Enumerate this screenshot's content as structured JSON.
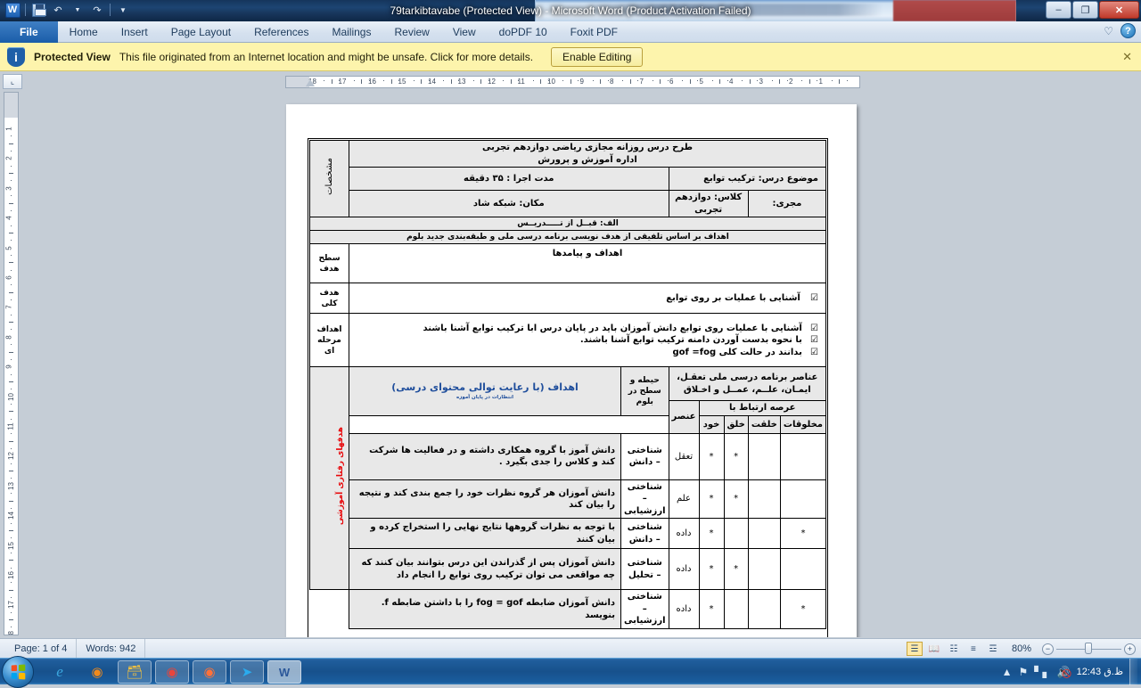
{
  "titlebar": {
    "document_title": "79tarkibtavabe (Protected View)  -  Microsoft Word (Product Activation Failed)",
    "quick_access": [
      "word-icon",
      "save-icon",
      "undo-icon",
      "redo-icon",
      "customize-icon"
    ],
    "minimize_label": "–",
    "restore_label": "❐",
    "close_label": "✕"
  },
  "ribbon": {
    "tabs": [
      {
        "label": "File",
        "active": true
      },
      {
        "label": "Home",
        "active": false
      },
      {
        "label": "Insert",
        "active": false
      },
      {
        "label": "Page Layout",
        "active": false
      },
      {
        "label": "References",
        "active": false
      },
      {
        "label": "Mailings",
        "active": false
      },
      {
        "label": "Review",
        "active": false
      },
      {
        "label": "View",
        "active": false
      },
      {
        "label": "doPDF 10",
        "active": false
      },
      {
        "label": "Foxit PDF",
        "active": false
      }
    ],
    "minimize_ribbon_label": "♡",
    "help_label": "?"
  },
  "protected_view": {
    "title": "Protected View",
    "message": "This file originated from an Internet location and might be unsafe. Click for more details.",
    "enable_button": "Enable Editing",
    "close_label": "✕",
    "bar_color": "#fdf4ac"
  },
  "rulers": {
    "horizontal_ticks": [
      "18",
      "17",
      "16",
      "15",
      "14",
      "13",
      "12",
      "11",
      "10",
      "9",
      "8",
      "7",
      "6",
      "5",
      "4",
      "3",
      "2",
      "1"
    ],
    "vertical_ticks": [
      "1",
      "2",
      "3",
      "4",
      "5",
      "6",
      "7",
      "8",
      "9",
      "10",
      "11",
      "12",
      "13",
      "14",
      "15",
      "16",
      "17",
      "18"
    ]
  },
  "document": {
    "header_title_line1": "طرح درس روزانه مجازی ریاضی دوازدهم تجربی",
    "header_title_line2": "اداره آموزش و پرورش",
    "side_label_specs": "مشخصات",
    "subject_label": "موضوع درس: ترکیب توابع",
    "duration_label": "مدت اجرا :  ۳۵ دقیقه",
    "teacher_label": "مجری:",
    "class_label": "کلاس: دوازدهم تجربی",
    "place_label": "مکان: شبکه شاد",
    "section_a": "الف: قبــل از تـــــدریــس",
    "goals_basis": "اهداف بر اساس تلفیقی از هدف نویسی برنامه درسی ملی و طبقه‌بندی جدید بلوم",
    "level_label": "سطح هدف",
    "goals_outcomes": "اهداف و پیامدها",
    "overall_goal_label": "هدف کلی",
    "overall_goal_text": "آشنایی با عملیات بر روی توابع",
    "stage_goals_label": "اهداف مرحله ای",
    "stage_goals": [
      "آشنایی با عملیات روی توابع دانش آموزان باید در پایان درس ابا ترکیب توابع آشنا باشند",
      "با نحوه بدست آوردن دامنه ترکیب توابع آشنا باشند.",
      "بدانند در حالت کلی gof =fog"
    ],
    "checkbox_glyph": "☑",
    "table_headers": {
      "objectives": "اهداف (با رعایت توالی محتوای درسی)",
      "objectives_sub": "انتظارات در پایان آموزه",
      "bloom": "حیطه و سطح در بلوم",
      "national_elements": "عناصر برنامه درسی ملی تعقـل، ایمـان، علــم، عمــل و اخـلاق",
      "element": "عنصر",
      "relation_to": "عرصه ارتباط با",
      "sub_cols": [
        "مخلوقات",
        "خلقت",
        "خلق",
        "خود"
      ]
    },
    "behavioral_label": "هدفهای رفتاری آموزشی",
    "rows": [
      {
        "objective": "دانش آموز با گروه همکاری داشته و در فعالیت ها شرکت کند و کلاس را جدی بگیرد .",
        "bloom": "شناختی – دانش",
        "element": "تعقل",
        "stars": [
          "",
          "*",
          "",
          "",
          "*"
        ]
      },
      {
        "objective": "دانش آموزان هر گروه نظرات خود را جمع بندی کند و نتیجه را بیان کند",
        "bloom": "شناختی – ارزشیابی",
        "element": "علم",
        "stars": [
          "",
          "*",
          "",
          "",
          "*"
        ]
      },
      {
        "objective": "با توجه به نظرات گروهها نتایج نهایی را استخراج کرده و بیان کنند",
        "bloom": "شناختی – دانش",
        "element": "داده",
        "stars": [
          "",
          "",
          "",
          "*",
          "*"
        ]
      },
      {
        "objective": "دانش آموزان پس از گذراندن این درس بتوانند بیان کنند که چه مواقعی می توان ترکیب روی توابع را انجام داد",
        "bloom": "شناختی – تحلیل",
        "element": "داده",
        "stars": [
          "",
          "*",
          "",
          "",
          "*"
        ]
      },
      {
        "objective": "دانش آموزان ضابطه fog = gof را با داشتن ضابطه f. بنویسد",
        "bloom": "شناختی – ارزشیابی",
        "element": "داده",
        "stars": [
          "",
          "",
          "",
          "*",
          "*"
        ]
      }
    ]
  },
  "statusbar": {
    "page": "Page: 1 of 4",
    "words": "Words: 942",
    "zoom": "80%",
    "view_buttons": [
      "print-layout-icon",
      "full-screen-reading-icon",
      "web-layout-icon",
      "outline-icon",
      "draft-icon"
    ],
    "zoom_out_label": "−",
    "zoom_in_label": "+"
  },
  "taskbar": {
    "start_label": "start-orb",
    "items": [
      {
        "name": "internet-explorer-icon",
        "glyph": "e"
      },
      {
        "name": "media-player-icon",
        "glyph": "▶"
      },
      {
        "name": "windows-explorer-icon",
        "glyph": "🗀"
      },
      {
        "name": "google-chrome-icon",
        "glyph": "●"
      },
      {
        "name": "firefox-icon",
        "glyph": "●"
      },
      {
        "name": "telegram-icon",
        "glyph": "➤"
      },
      {
        "name": "word-taskbar-icon",
        "glyph": "W"
      }
    ],
    "tray": {
      "show_hidden_label": "▲",
      "network_label": "network-icon",
      "volume_label": "volume-muted-icon",
      "clock": "12:43 ظ.ق"
    }
  }
}
